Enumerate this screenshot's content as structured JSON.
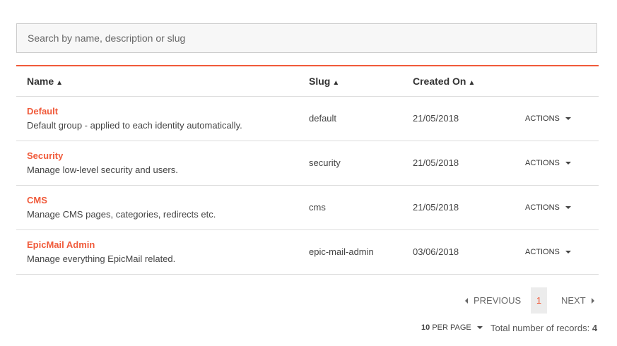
{
  "search": {
    "placeholder": "Search by name, description or slug"
  },
  "columns": {
    "name": "Name",
    "slug": "Slug",
    "created": "Created On"
  },
  "sort_icon": "sort-icon",
  "rows": [
    {
      "name": "Default",
      "description": "Default group - applied to each identity automatically.",
      "slug": "default",
      "created": "21/05/2018",
      "actions": "ACTIONS"
    },
    {
      "name": "Security",
      "description": "Manage low-level security and users.",
      "slug": "security",
      "created": "21/05/2018",
      "actions": "ACTIONS"
    },
    {
      "name": "CMS",
      "description": "Manage CMS pages, categories, redirects etc.",
      "slug": "cms",
      "created": "21/05/2018",
      "actions": "ACTIONS"
    },
    {
      "name": "EpicMail Admin",
      "description": "Manage everything EpicMail related.",
      "slug": "epic-mail-admin",
      "created": "03/06/2018",
      "actions": "ACTIONS"
    }
  ],
  "pagination": {
    "previous": "PREVIOUS",
    "current": "1",
    "next": "NEXT",
    "per_page_count": "10",
    "per_page_label": "PER PAGE",
    "total_label": "Total number of records:",
    "total": "4"
  },
  "colors": {
    "accent": "#f05a3a"
  }
}
